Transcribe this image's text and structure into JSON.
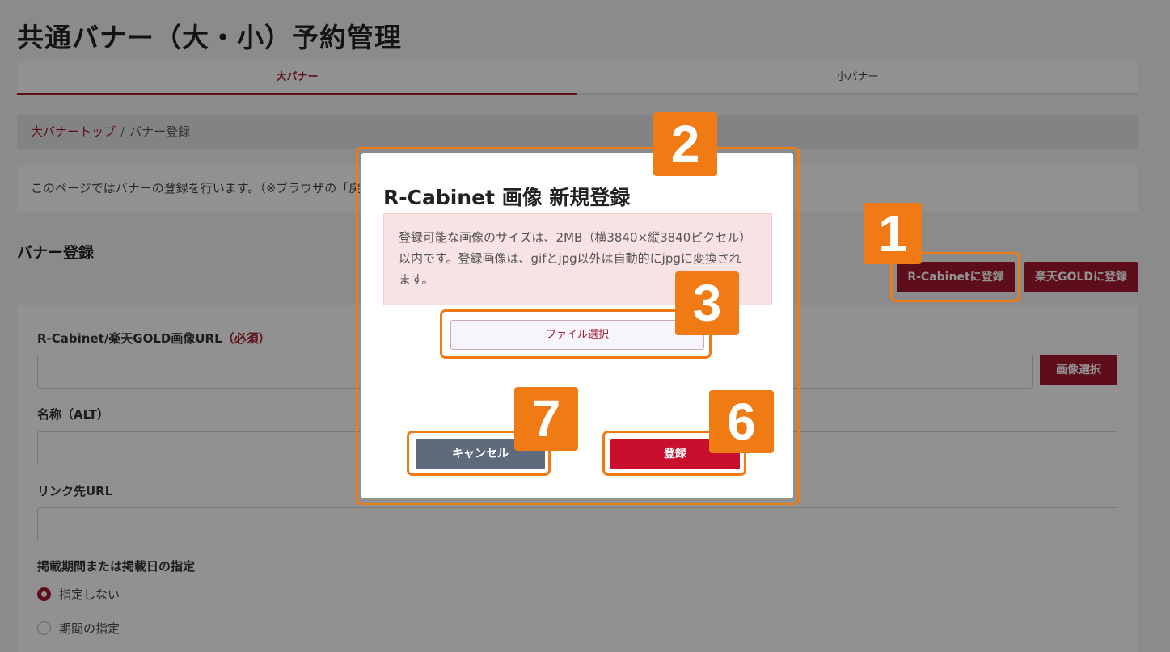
{
  "page": {
    "title": "共通バナー（大・小）予約管理",
    "tabs": [
      {
        "label": "大バナー"
      },
      {
        "label": "小バナー"
      }
    ],
    "breadcrumb": {
      "link": "大バナートップ",
      "separator": "/",
      "current": "バナー登録"
    },
    "notice": "このページではバナーの登録を行います。（※ブラウザの「戻る",
    "section_title": "バナー登録",
    "buttons": {
      "rcabinet": "R-Cabinetに登録",
      "gold": "楽天GOLDに登録",
      "image_select": "画像選択"
    },
    "form": {
      "url_label": "R-Cabinet/楽天GOLD画像URL",
      "required": "（必須）",
      "url_value": "",
      "alt_label": "名称（ALT）",
      "alt_value": "",
      "link_label": "リンク先URL",
      "link_value": "",
      "period_label": "掲載期間または掲載日の指定",
      "radio_options": [
        {
          "label": "指定しない",
          "checked": true
        },
        {
          "label": "期間の指定",
          "checked": false
        }
      ]
    }
  },
  "modal": {
    "title": "R-Cabinet 画像 新規登録",
    "alert_lines": [
      "登録可能な画像のサイズは、2MB（横3840×縦3840ピクセル）",
      "以内です。登録画像は、gifとjpg以外は自動的にjpgに変換され",
      "ます。"
    ],
    "file_button": "ファイル選択",
    "cancel_button": "キャンセル",
    "submit_button": "登録"
  },
  "annotations": {
    "badges": [
      "1",
      "2",
      "3",
      "6",
      "7"
    ],
    "color": "#f07a14"
  },
  "colors": {
    "brand": "#a6192e",
    "submit": "#c8102e",
    "cancel": "#5f6b7d",
    "alert_bg": "#f8e3e4"
  }
}
